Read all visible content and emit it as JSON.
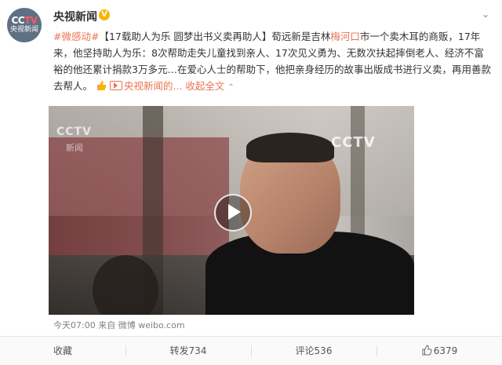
{
  "header": {
    "avatar_logo_a": "CC",
    "avatar_logo_b": "TV",
    "avatar_text": "央视新闻",
    "username": "央视新闻",
    "verified_mark": "V"
  },
  "post": {
    "hashtag": "#微感动#",
    "title": "【17载助人为乐 圆梦出书义卖再助人】",
    "text_a": "荀远新是吉林",
    "location": "梅河口",
    "text_b": "市一个卖木耳的商贩，17年来，他坚持助人为乐：8次帮助走失儿童找到亲人、17次见义勇为、无数次扶起摔倒老人、经济不富裕的他还累计捐款3万多元…在爱心人士的帮助下，他把亲身经历的故事出版成书进行义卖，再用善款去帮人。",
    "video_link_text": "央视新闻的...",
    "collapse_text": "收起全文"
  },
  "video": {
    "watermark_left": "CCTV",
    "watermark_left_sub": "新闻",
    "watermark_right": "CCTV"
  },
  "meta": {
    "time": "今天07:00",
    "from_label": "来自",
    "source": "微博 weibo.com"
  },
  "footer": {
    "favorite": "收藏",
    "repost": "转发734",
    "comment": "评论536",
    "like": "6379"
  },
  "colors": {
    "accent": "#eb7350",
    "verified": "#f7b500"
  },
  "icons": [
    "chevron-down-icon",
    "thumbs-up-icon",
    "video-icon",
    "play-icon",
    "like-icon"
  ]
}
